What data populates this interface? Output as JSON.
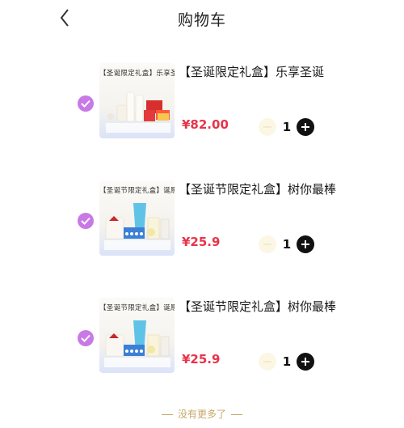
{
  "header": {
    "title": "购物车"
  },
  "items": [
    {
      "banner": "【圣诞限定礼盒】乐享圣诞",
      "name": "【圣诞限定礼盒】乐享圣诞",
      "price": "¥82.00",
      "qty": "1"
    },
    {
      "banner": "【圣诞节限定礼盒】诞愿实现",
      "name": "【圣诞节限定礼盒】树你最棒",
      "price": "¥25.9",
      "qty": "1"
    },
    {
      "banner": "【圣诞节限定礼盒】诞愿实现",
      "name": "【圣诞节限定礼盒】树你最棒",
      "price": "¥25.9",
      "qty": "1"
    }
  ],
  "footer": {
    "text": "没有更多了"
  },
  "colors": {
    "accent": "#c879e6",
    "price": "#e8334a",
    "footer": "#c8a867"
  }
}
